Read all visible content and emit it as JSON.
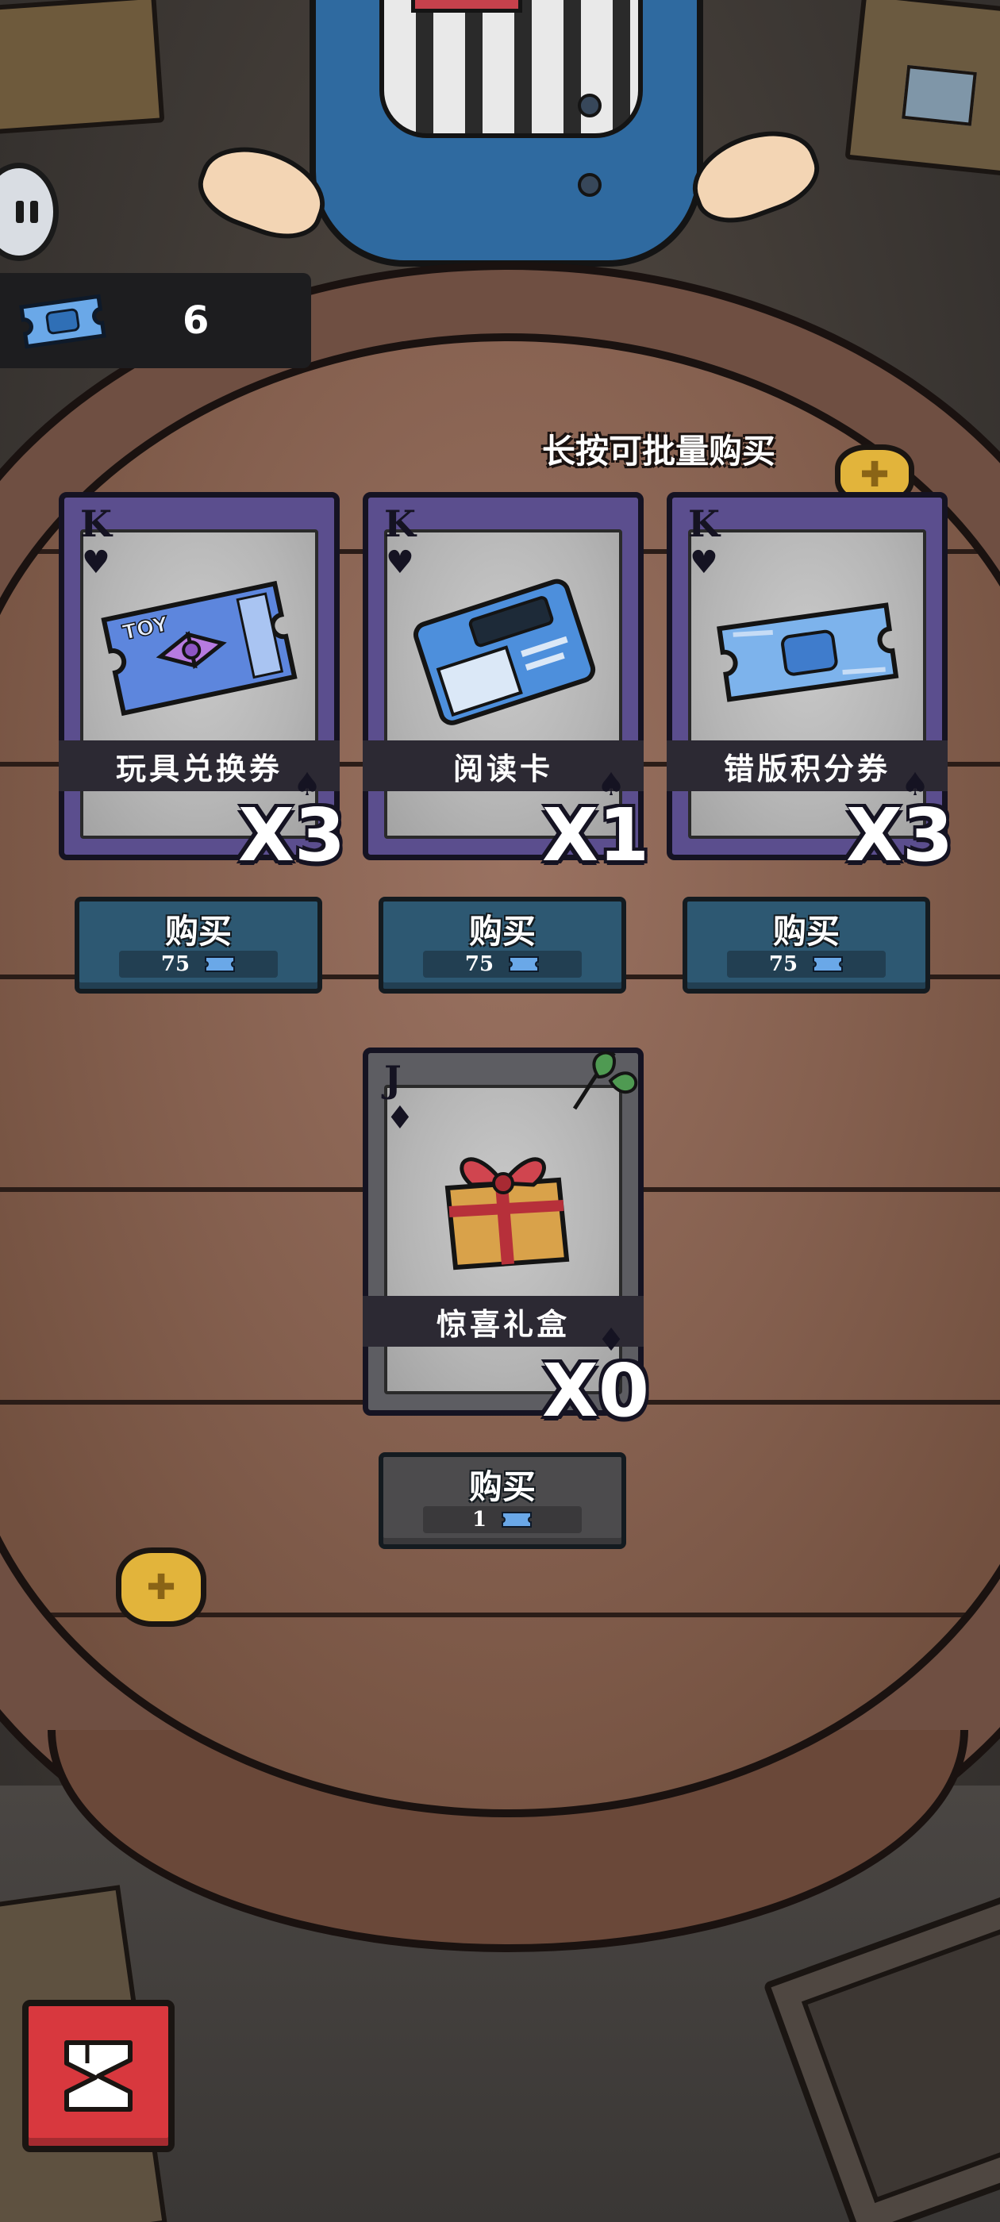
{
  "hud": {
    "ticket_count": "6",
    "hint": "长按可批量购买"
  },
  "shop": {
    "items": [
      {
        "name": "玩具兑换券",
        "rank": "K",
        "suit": "♥",
        "corner_suit": "♠",
        "count": "X3",
        "buy_label": "购买",
        "price": "75",
        "style": "purple",
        "icon": "toy-ticket-icon"
      },
      {
        "name": "阅读卡",
        "rank": "K",
        "suit": "♥",
        "corner_suit": "♠",
        "count": "X1",
        "buy_label": "购买",
        "price": "75",
        "style": "purple",
        "icon": "reading-card-icon"
      },
      {
        "name": "错版积分券",
        "rank": "K",
        "suit": "♥",
        "corner_suit": "♠",
        "count": "X3",
        "buy_label": "购买",
        "price": "75",
        "style": "purple",
        "icon": "misprint-ticket-icon"
      },
      {
        "name": "惊喜礼盒",
        "rank": "J",
        "suit": "♦",
        "corner_suit": "♦",
        "count": "X0",
        "buy_label": "购买",
        "price": "1",
        "style": "gray",
        "icon": "gift-box-icon"
      }
    ]
  },
  "colors": {
    "card_purple": "#5b4e8e",
    "card_gray": "#5d5d62",
    "buy_blue": "#2d5872",
    "buy_disabled": "#4c4b4d",
    "exit_red": "#d8383e",
    "ticket_blue": "#6aa8e8"
  },
  "icons": {
    "pause": "pause-icon",
    "currency": "blue-ticket-icon",
    "exit": "exit-icon",
    "coin": "gold-coin-icon"
  }
}
